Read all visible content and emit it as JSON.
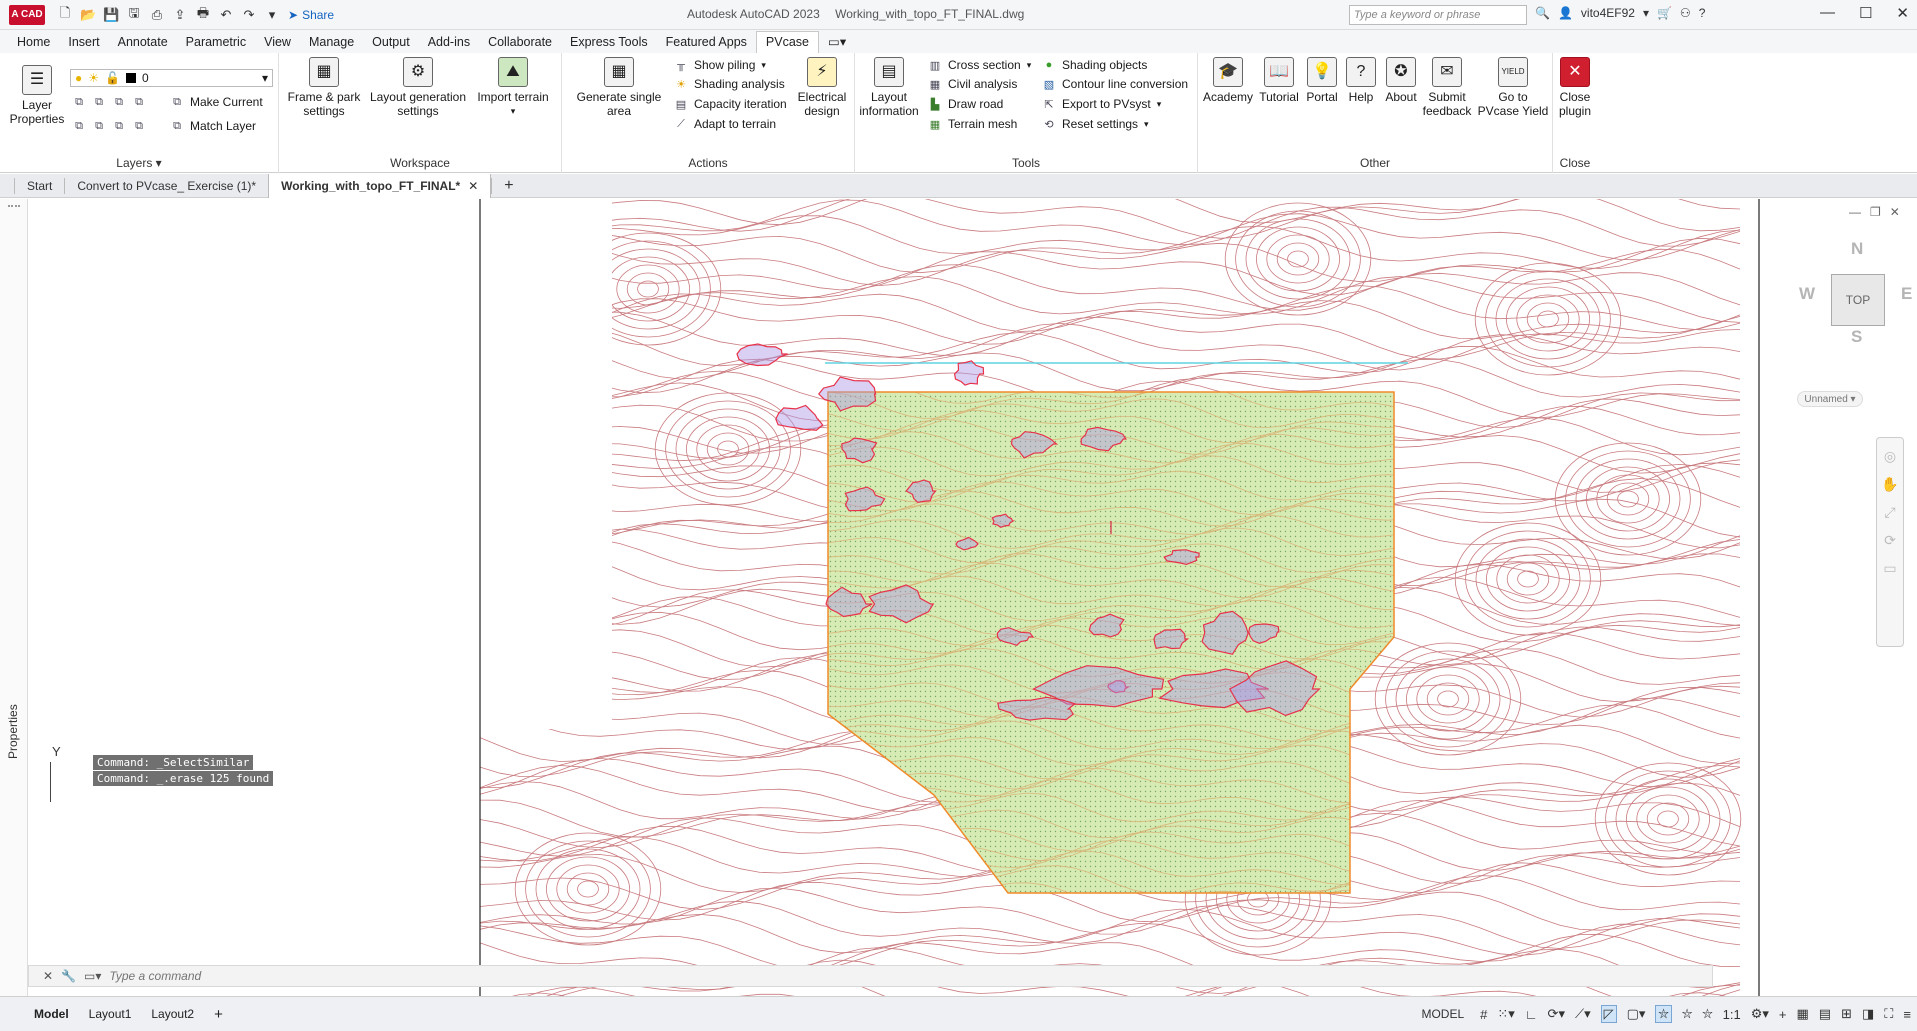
{
  "titlebar": {
    "logo": "A CAD",
    "share": "Share",
    "app_name": "Autodesk AutoCAD 2023",
    "file_name": "Working_with_topo_FT_FINAL.dwg",
    "search_placeholder": "Type a keyword or phrase",
    "user": "vito4EF92"
  },
  "ribbon_tabs": [
    "Home",
    "Insert",
    "Annotate",
    "Parametric",
    "View",
    "Manage",
    "Output",
    "Add-ins",
    "Collaborate",
    "Express Tools",
    "Featured Apps",
    "PVcase"
  ],
  "ribbon": {
    "layers": {
      "title": "Layers",
      "layer_properties": "Layer\nProperties",
      "layer_value": "0",
      "make_current": "Make Current",
      "match_layer": "Match Layer"
    },
    "workspace": {
      "title": "Workspace",
      "frame": "Frame & park\nsettings",
      "layout_gen": "Layout generation\nsettings",
      "import_terrain": "Import terrain"
    },
    "actions": {
      "title": "Actions",
      "generate": "Generate single\narea",
      "show_piling": "Show piling",
      "shading_analysis": "Shading analysis",
      "capacity": "Capacity iteration",
      "adapt": "Adapt to terrain",
      "electrical": "Electrical\ndesign"
    },
    "tools": {
      "title": "Tools",
      "layout_info": "Layout\ninformation",
      "cross_section": "Cross section",
      "civil": "Civil analysis",
      "draw_road": "Draw road",
      "terrain_mesh": "Terrain mesh",
      "shading_objects": "Shading objects",
      "contour": "Contour line conversion",
      "export": "Export to PVsyst",
      "reset": "Reset settings"
    },
    "other": {
      "title": "Other",
      "academy": "Academy",
      "tutorial": "Tutorial",
      "portal": "Portal",
      "help": "Help",
      "about": "About",
      "feedback": "Submit\nfeedback",
      "yield": "Go to\nPVcase Yield"
    },
    "close": {
      "title": "Close",
      "close_plugin": "Close\nplugin"
    }
  },
  "file_tabs": [
    "Start",
    "Convert to PVcase_ Exercise (1)*",
    "Working_with_topo_FT_FINAL*"
  ],
  "properties_label": "Properties",
  "viewcube": {
    "n": "N",
    "s": "S",
    "e": "E",
    "w": "W",
    "top": "TOP",
    "ucs": "Unnamed"
  },
  "ucs_y": "Y",
  "command": {
    "history": [
      "Command: _SelectSimilar",
      "Command: _.erase 125 found"
    ],
    "placeholder": "Type a command"
  },
  "status": {
    "layouts": [
      "Model",
      "Layout1",
      "Layout2"
    ],
    "model": "MODEL",
    "scale": "1:1"
  },
  "colors": {
    "contour": "#c97a7e",
    "boundary": "#f08a2a",
    "fill": "#cfe6a6",
    "shade": "#e8324a",
    "road": "#5fd3e0"
  }
}
